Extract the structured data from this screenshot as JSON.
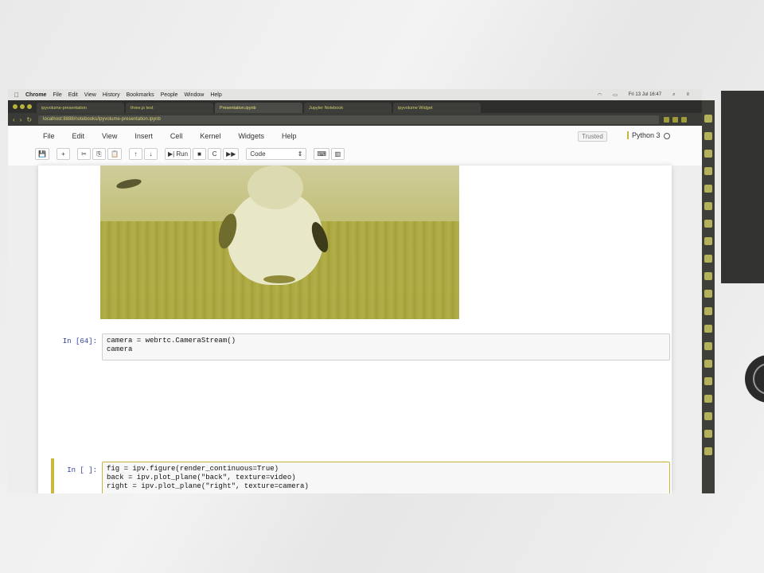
{
  "mac_menu": {
    "app": "Chrome",
    "items": [
      "File",
      "Edit",
      "View",
      "History",
      "Bookmarks",
      "People",
      "Window",
      "Help"
    ],
    "clock": "Fri 13 Jul 16:47"
  },
  "browser": {
    "tabs": [
      "ipyvolume-presentation",
      "three.js test",
      "Presentation.ipynb",
      "Jupyter Notebook",
      "ipyvolume Widget"
    ],
    "url": "localhost:8888/notebooks/ipyvolume-presentation.ipynb"
  },
  "jupyter": {
    "menu": [
      "File",
      "Edit",
      "View",
      "Insert",
      "Cell",
      "Kernel",
      "Widgets",
      "Help"
    ],
    "trusted": "Trusted",
    "kernel_name": "Python 3",
    "toolbar": {
      "save": "💾",
      "add": "+",
      "cut": "✂",
      "copy": "⎘",
      "paste": "📋",
      "up": "↑",
      "down": "↓",
      "run": "▶| Run",
      "stop": "■",
      "restart": "C",
      "fast_forward": "▶▶",
      "cell_type": "Code",
      "keyboard": "⌨",
      "chart": "▥"
    }
  },
  "cells": [
    {
      "prompt": "In [64]:",
      "lines": [
        "camera = webrtc.CameraStream()",
        "camera"
      ]
    },
    {
      "prompt": "In [ ]:",
      "lines": [
        "fig = ipv.figure(render_continuous=True)",
        "back = ipv.plot_plane(\"back\", texture=video)",
        "right = ipv.plot_plane(\"right\", texture=camera)"
      ]
    }
  ],
  "colors": {
    "accent": "#c6b63d",
    "prompt": "#303f9f"
  }
}
